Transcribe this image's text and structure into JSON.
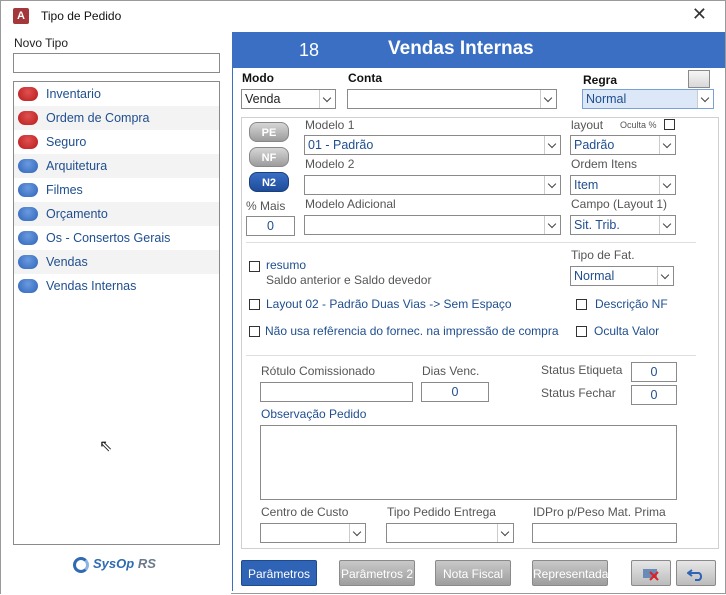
{
  "window": {
    "title": "Tipo de Pedido",
    "app_icon": "A"
  },
  "left": {
    "novo_tipo_label": "Novo Tipo",
    "novo_tipo_value": "",
    "items": [
      {
        "label": "Inventario",
        "color": "red"
      },
      {
        "label": "Ordem de Compra",
        "color": "red"
      },
      {
        "label": "Seguro",
        "color": "red"
      },
      {
        "label": "Arquitetura",
        "color": "blue"
      },
      {
        "label": "Filmes",
        "color": "blue"
      },
      {
        "label": "Orçamento",
        "color": "blue"
      },
      {
        "label": "Os - Consertos Gerais",
        "color": "blue"
      },
      {
        "label": "Vendas",
        "color": "blue"
      },
      {
        "label": "Vendas Internas",
        "color": "blue"
      }
    ],
    "logo": {
      "text": "SysOp",
      "suffix": "RS"
    }
  },
  "header": {
    "number": "18",
    "title": "Vendas Internas",
    "color": "#3a6fc4"
  },
  "top": {
    "modo_label": "Modo",
    "modo_value": "Venda",
    "conta_label": "Conta",
    "conta_value": "",
    "regra_label": "Regra",
    "regra_value": "Normal"
  },
  "pills": {
    "pe": "PE",
    "nf": "NF",
    "n2": "N2"
  },
  "fields": {
    "modelo1_label": "Modelo 1",
    "modelo1_value": "01 - Padrão",
    "modelo2_label": "Modelo 2",
    "modelo2_value": "",
    "modelo_adic_label": "Modelo Adicional",
    "modelo_adic_value": "",
    "mais_label": "% Mais",
    "mais_value": "0",
    "layout_label": "layout",
    "oculta_label": "Oculta %",
    "layout_value": "Padrão",
    "ordem_label": "Ordem Itens",
    "ordem_value": "Item",
    "campo_label": "Campo (Layout 1)",
    "campo_value": "Sit. Trib.",
    "tipo_fat_label": "Tipo de Fat.",
    "tipo_fat_value": "Normal"
  },
  "checks": {
    "resumo": "resumo",
    "resumo_desc": "Saldo anterior e Saldo devedor",
    "layout02": "Layout 02 - Padrão Duas Vias -> Sem Espaço",
    "nao_usa": "Não usa refêrencia do fornec. na impressão de compra",
    "descricao_nf": "Descrição NF",
    "oculta_valor": "Oculta Valor"
  },
  "lower": {
    "rotulo_label": "Rótulo Comissionado",
    "dias_label": "Dias Venc.",
    "dias_value": "0",
    "status_etq_label": "Status Etiqueta",
    "status_etq_value": "0",
    "status_fechar_label": "Status Fechar",
    "status_fechar_value": "0",
    "obs_label": "Observação Pedido",
    "centro_label": "Centro de Custo",
    "tipo_entrega_label": "Tipo Pedido Entrega",
    "idpro_label": "IDPro p/Peso Mat. Prima"
  },
  "buttons": {
    "parametros": "Parâmetros",
    "parametros2": "Parâmetros 2",
    "nota_fiscal": "Nota Fiscal",
    "representada": "Representada"
  }
}
